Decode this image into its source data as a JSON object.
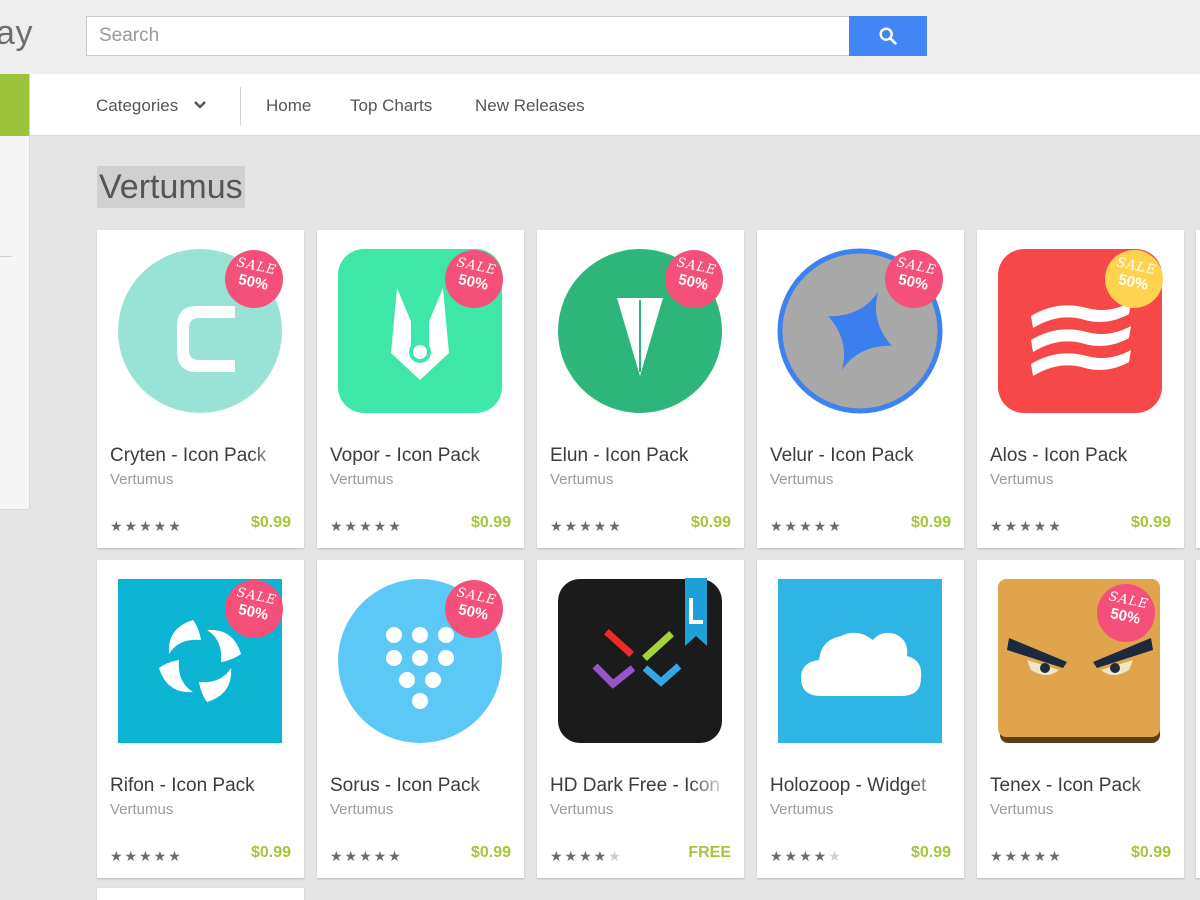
{
  "app": {
    "logo_text": "lay"
  },
  "search": {
    "placeholder": "Search",
    "button_icon": "search-icon"
  },
  "nav": {
    "categories_label": "Categories",
    "items": [
      "Home",
      "Top Charts",
      "New Releases"
    ]
  },
  "page": {
    "title": "Vertumus"
  },
  "sale_badge": {
    "line1": "SALE",
    "line2": "50%"
  },
  "colors": {
    "accent_green": "#a4c639",
    "search_blue": "#4285f4",
    "sale_pink": "#f4507a",
    "sale_yellow": "#ffd34f"
  },
  "apps": [
    {
      "title": "Cryten - Icon Pack",
      "developer": "Vertumus",
      "rating": 4.5,
      "price": "$0.99",
      "sale": true,
      "icon": "cryten-icon"
    },
    {
      "title": "Vopor - Icon Pack",
      "developer": "Vertumus",
      "rating": 4.5,
      "price": "$0.99",
      "sale": true,
      "icon": "vopor-icon"
    },
    {
      "title": "Elun - Icon Pack",
      "developer": "Vertumus",
      "rating": 4.5,
      "price": "$0.99",
      "sale": true,
      "icon": "elun-icon"
    },
    {
      "title": "Velur - Icon Pack",
      "developer": "Vertumus",
      "rating": 4.5,
      "price": "$0.99",
      "sale": true,
      "icon": "velur-icon"
    },
    {
      "title": "Alos - Icon Pack",
      "developer": "Vertumus",
      "rating": 4.5,
      "price": "$0.99",
      "sale": true,
      "icon": "alos-icon"
    },
    {
      "title": "Rifon - Icon Pack",
      "developer": "Vertumus",
      "rating": 4.5,
      "price": "$0.99",
      "sale": true,
      "icon": "rifon-icon"
    },
    {
      "title": "Sorus - Icon Pack",
      "developer": "Vertumus",
      "rating": 5,
      "price": "$0.99",
      "sale": true,
      "icon": "sorus-icon"
    },
    {
      "title": "HD Dark Free - Icon",
      "developer": "Vertumus",
      "rating": 4,
      "price": "FREE",
      "sale": false,
      "icon": "hd-dark-icon"
    },
    {
      "title": "Holozoop - Widget",
      "developer": "Vertumus",
      "rating": 4,
      "price": "$0.99",
      "sale": false,
      "icon": "holozoop-icon"
    },
    {
      "title": "Tenex - Icon Pack",
      "developer": "Vertumus",
      "rating": 4.5,
      "price": "$0.99",
      "sale": true,
      "icon": "tenex-icon"
    }
  ]
}
